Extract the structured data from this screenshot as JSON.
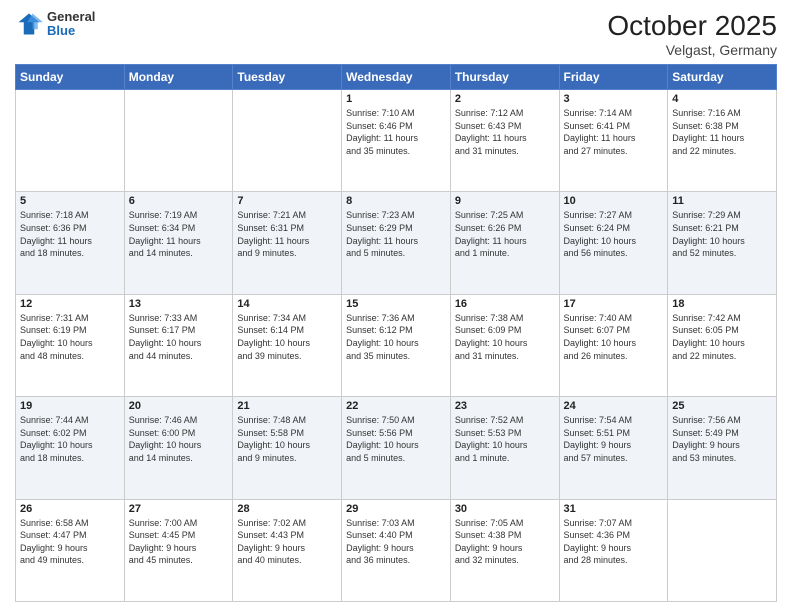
{
  "header": {
    "logo": {
      "general": "General",
      "blue": "Blue"
    },
    "title": "October 2025",
    "location": "Velgast, Germany"
  },
  "weekdays": [
    "Sunday",
    "Monday",
    "Tuesday",
    "Wednesday",
    "Thursday",
    "Friday",
    "Saturday"
  ],
  "weeks": [
    [
      {
        "day": "",
        "info": ""
      },
      {
        "day": "",
        "info": ""
      },
      {
        "day": "",
        "info": ""
      },
      {
        "day": "1",
        "info": "Sunrise: 7:10 AM\nSunset: 6:46 PM\nDaylight: 11 hours\nand 35 minutes."
      },
      {
        "day": "2",
        "info": "Sunrise: 7:12 AM\nSunset: 6:43 PM\nDaylight: 11 hours\nand 31 minutes."
      },
      {
        "day": "3",
        "info": "Sunrise: 7:14 AM\nSunset: 6:41 PM\nDaylight: 11 hours\nand 27 minutes."
      },
      {
        "day": "4",
        "info": "Sunrise: 7:16 AM\nSunset: 6:38 PM\nDaylight: 11 hours\nand 22 minutes."
      }
    ],
    [
      {
        "day": "5",
        "info": "Sunrise: 7:18 AM\nSunset: 6:36 PM\nDaylight: 11 hours\nand 18 minutes."
      },
      {
        "day": "6",
        "info": "Sunrise: 7:19 AM\nSunset: 6:34 PM\nDaylight: 11 hours\nand 14 minutes."
      },
      {
        "day": "7",
        "info": "Sunrise: 7:21 AM\nSunset: 6:31 PM\nDaylight: 11 hours\nand 9 minutes."
      },
      {
        "day": "8",
        "info": "Sunrise: 7:23 AM\nSunset: 6:29 PM\nDaylight: 11 hours\nand 5 minutes."
      },
      {
        "day": "9",
        "info": "Sunrise: 7:25 AM\nSunset: 6:26 PM\nDaylight: 11 hours\nand 1 minute."
      },
      {
        "day": "10",
        "info": "Sunrise: 7:27 AM\nSunset: 6:24 PM\nDaylight: 10 hours\nand 56 minutes."
      },
      {
        "day": "11",
        "info": "Sunrise: 7:29 AM\nSunset: 6:21 PM\nDaylight: 10 hours\nand 52 minutes."
      }
    ],
    [
      {
        "day": "12",
        "info": "Sunrise: 7:31 AM\nSunset: 6:19 PM\nDaylight: 10 hours\nand 48 minutes."
      },
      {
        "day": "13",
        "info": "Sunrise: 7:33 AM\nSunset: 6:17 PM\nDaylight: 10 hours\nand 44 minutes."
      },
      {
        "day": "14",
        "info": "Sunrise: 7:34 AM\nSunset: 6:14 PM\nDaylight: 10 hours\nand 39 minutes."
      },
      {
        "day": "15",
        "info": "Sunrise: 7:36 AM\nSunset: 6:12 PM\nDaylight: 10 hours\nand 35 minutes."
      },
      {
        "day": "16",
        "info": "Sunrise: 7:38 AM\nSunset: 6:09 PM\nDaylight: 10 hours\nand 31 minutes."
      },
      {
        "day": "17",
        "info": "Sunrise: 7:40 AM\nSunset: 6:07 PM\nDaylight: 10 hours\nand 26 minutes."
      },
      {
        "day": "18",
        "info": "Sunrise: 7:42 AM\nSunset: 6:05 PM\nDaylight: 10 hours\nand 22 minutes."
      }
    ],
    [
      {
        "day": "19",
        "info": "Sunrise: 7:44 AM\nSunset: 6:02 PM\nDaylight: 10 hours\nand 18 minutes."
      },
      {
        "day": "20",
        "info": "Sunrise: 7:46 AM\nSunset: 6:00 PM\nDaylight: 10 hours\nand 14 minutes."
      },
      {
        "day": "21",
        "info": "Sunrise: 7:48 AM\nSunset: 5:58 PM\nDaylight: 10 hours\nand 9 minutes."
      },
      {
        "day": "22",
        "info": "Sunrise: 7:50 AM\nSunset: 5:56 PM\nDaylight: 10 hours\nand 5 minutes."
      },
      {
        "day": "23",
        "info": "Sunrise: 7:52 AM\nSunset: 5:53 PM\nDaylight: 10 hours\nand 1 minute."
      },
      {
        "day": "24",
        "info": "Sunrise: 7:54 AM\nSunset: 5:51 PM\nDaylight: 9 hours\nand 57 minutes."
      },
      {
        "day": "25",
        "info": "Sunrise: 7:56 AM\nSunset: 5:49 PM\nDaylight: 9 hours\nand 53 minutes."
      }
    ],
    [
      {
        "day": "26",
        "info": "Sunrise: 6:58 AM\nSunset: 4:47 PM\nDaylight: 9 hours\nand 49 minutes."
      },
      {
        "day": "27",
        "info": "Sunrise: 7:00 AM\nSunset: 4:45 PM\nDaylight: 9 hours\nand 45 minutes."
      },
      {
        "day": "28",
        "info": "Sunrise: 7:02 AM\nSunset: 4:43 PM\nDaylight: 9 hours\nand 40 minutes."
      },
      {
        "day": "29",
        "info": "Sunrise: 7:03 AM\nSunset: 4:40 PM\nDaylight: 9 hours\nand 36 minutes."
      },
      {
        "day": "30",
        "info": "Sunrise: 7:05 AM\nSunset: 4:38 PM\nDaylight: 9 hours\nand 32 minutes."
      },
      {
        "day": "31",
        "info": "Sunrise: 7:07 AM\nSunset: 4:36 PM\nDaylight: 9 hours\nand 28 minutes."
      },
      {
        "day": "",
        "info": ""
      }
    ]
  ]
}
